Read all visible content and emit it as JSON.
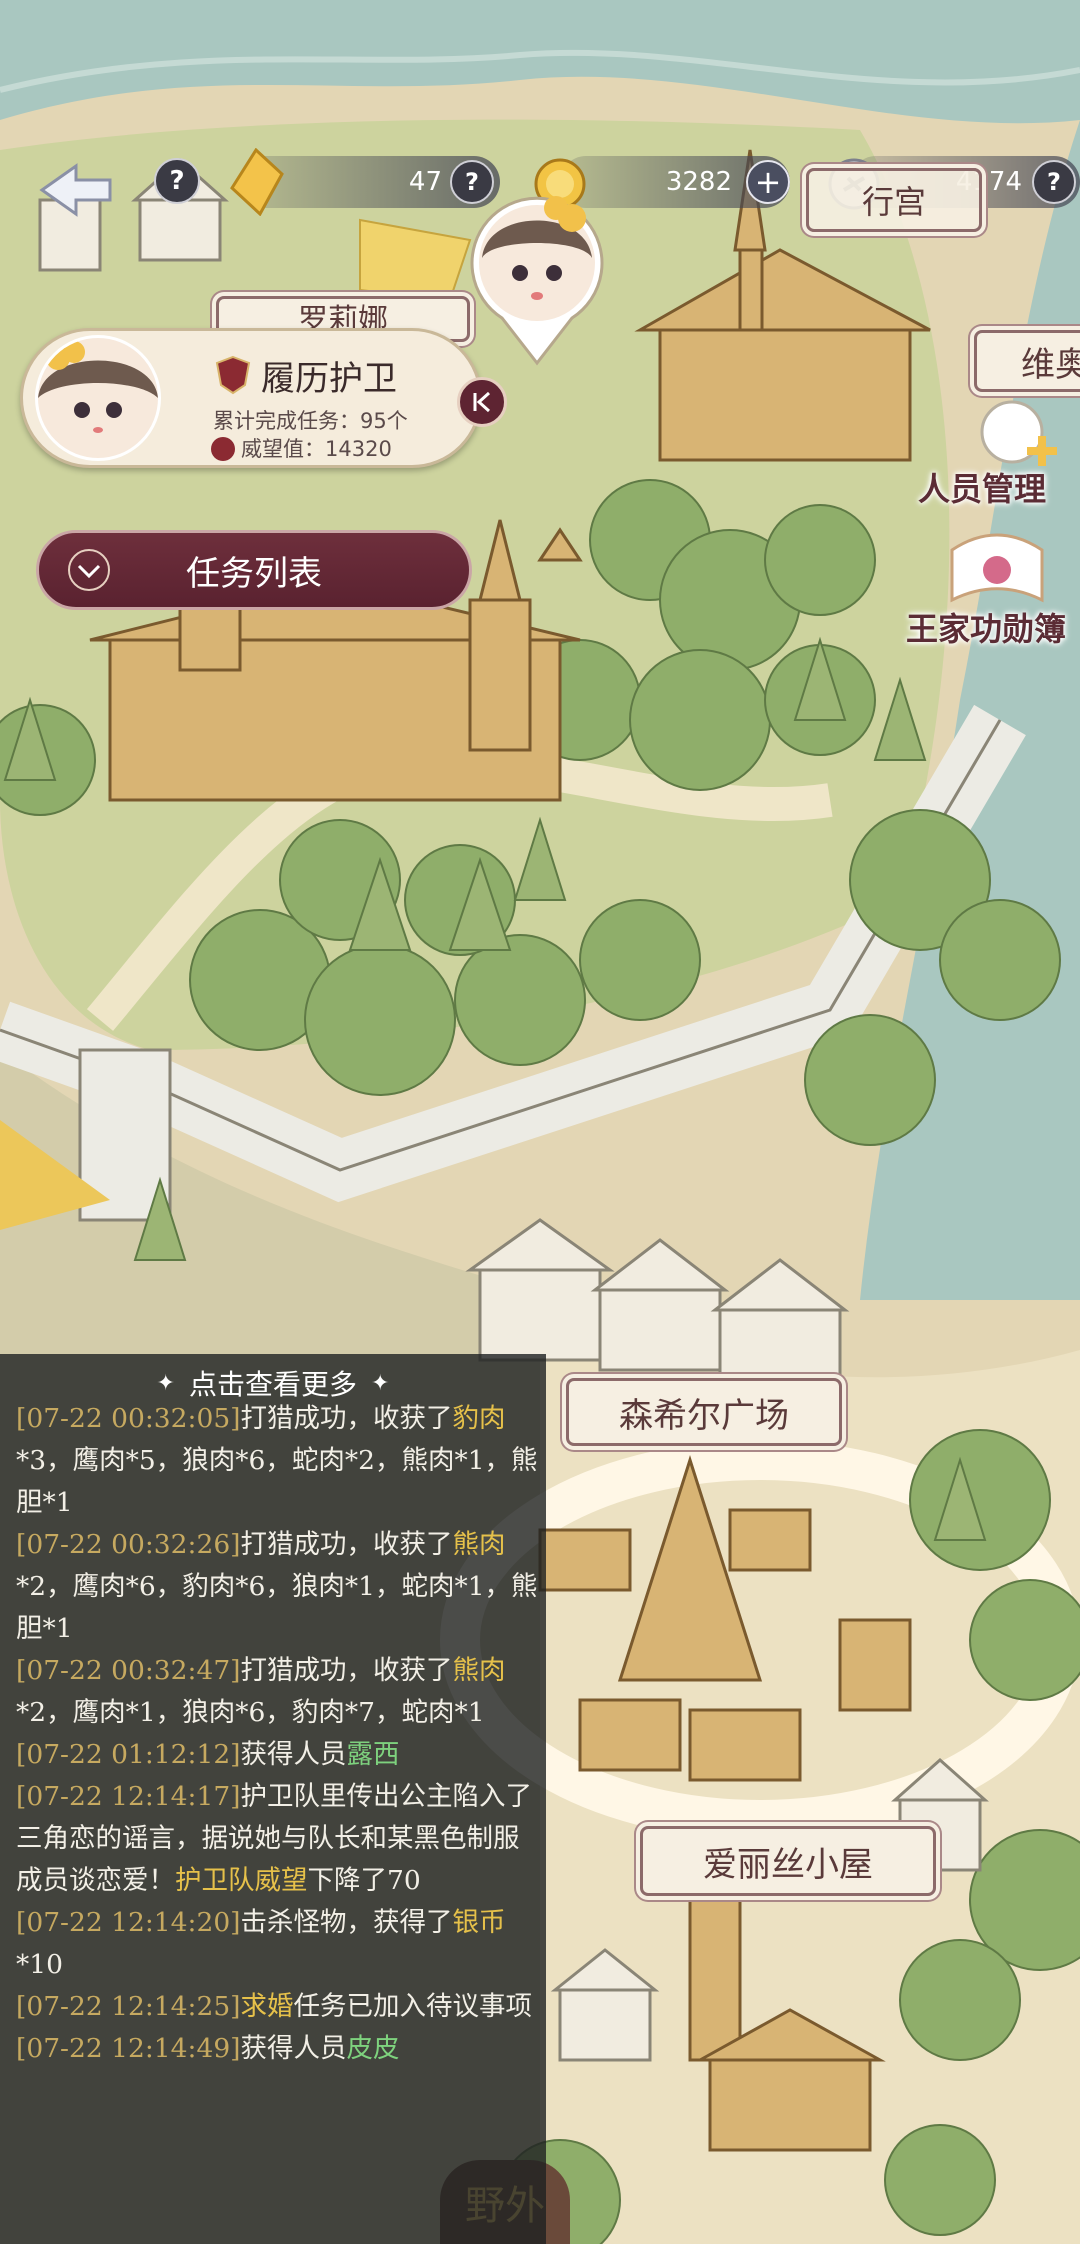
{
  "topbar": {
    "gem_count": "47",
    "coin_count": "3282",
    "silver_count": "4174",
    "help_symbol": "?",
    "plus_symbol": "+",
    "back_icon": "back-arrow-icon"
  },
  "map_labels": {
    "top_left_partial": "罗莉娜",
    "top_right_partial": "维奥",
    "palace": "行宫",
    "square": "森希尔广场",
    "cottage": "爱丽丝小屋",
    "bottom_partial": "野外"
  },
  "side_buttons": {
    "staff": "人员管理",
    "merit": "王家功勋簿"
  },
  "guard_card": {
    "title": "履历护卫",
    "tasks_label": "累计完成任务：95个",
    "prestige_label": "威望值：14320"
  },
  "task_button": {
    "label": "任务列表"
  },
  "log": {
    "header": "点击查看更多",
    "entries": [
      {
        "ts": "[07-22 00:32:05]",
        "parts": [
          {
            "t": "打猎成功，收获了"
          },
          {
            "t": "豹肉",
            "c": "y"
          },
          {
            "t": "*3，鹰肉*5，狼肉*6，蛇肉*2，熊肉*1，熊胆*1"
          }
        ]
      },
      {
        "ts": "[07-22 00:32:26]",
        "parts": [
          {
            "t": "打猎成功，收获了"
          },
          {
            "t": "熊肉",
            "c": "y"
          },
          {
            "t": "*2，鹰肉*6，豹肉*6，狼肉*1，蛇肉*1，熊胆*1"
          }
        ]
      },
      {
        "ts": "[07-22 00:32:47]",
        "parts": [
          {
            "t": "打猎成功，收获了"
          },
          {
            "t": "熊肉",
            "c": "y"
          },
          {
            "t": "*2，鹰肉*1，狼肉*6，豹肉*7，蛇肉*1"
          }
        ]
      },
      {
        "ts": "[07-22 01:12:12]",
        "parts": [
          {
            "t": "获得人员"
          },
          {
            "t": "露西",
            "c": "g"
          }
        ]
      },
      {
        "ts": "[07-22 12:14:17]",
        "parts": [
          {
            "t": "护卫队里传出公主陷入了三角恋的谣言，据说她与队长和某黑色制服成员谈恋爱！"
          },
          {
            "t": "护卫队威望",
            "c": "y"
          },
          {
            "t": "下降了70"
          }
        ]
      },
      {
        "ts": "[07-22 12:14:20]",
        "parts": [
          {
            "t": "击杀怪物，获得了"
          },
          {
            "t": "银币",
            "c": "y"
          },
          {
            "t": "*10"
          }
        ]
      },
      {
        "ts": "[07-22 12:14:25]",
        "parts": [
          {
            "t": "求婚",
            "c": "y"
          },
          {
            "t": "任务已加入待议事项"
          }
        ]
      },
      {
        "ts": "[07-22 12:14:49]",
        "parts": [
          {
            "t": "获得人员"
          },
          {
            "t": "皮皮",
            "c": "g"
          }
        ]
      }
    ]
  },
  "colors": {
    "river": "#a9c7c0",
    "grass": "#c9cf9a",
    "tree": "#8fae6a",
    "building": "#d8b474",
    "wall": "#ecebe4",
    "accent_maroon": "#5e2432",
    "log_highlight_yellow": "#e6c14a",
    "log_highlight_green": "#7ed27e"
  }
}
